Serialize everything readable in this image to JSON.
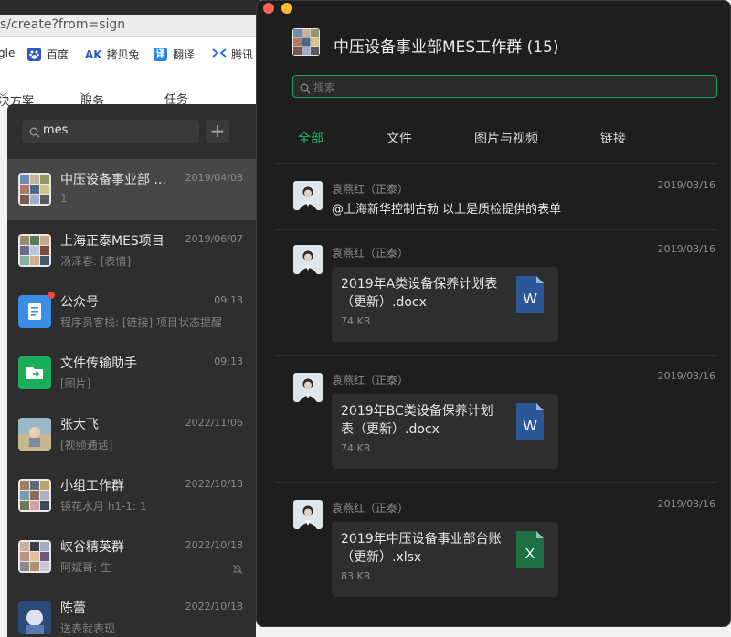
{
  "browser": {
    "url": "s/create?from=sign",
    "bookmarks": [
      {
        "label": "gle",
        "icon": "google-bookmark-icon",
        "color": "#ffffff"
      },
      {
        "label": "百度",
        "icon": "baidu-paw-icon",
        "color": "#2e57c8"
      },
      {
        "label": "拷贝兔",
        "icon": "ak-icon",
        "color": "#2e57c8",
        "icon_text": "AK"
      },
      {
        "label": "翻译",
        "icon": "translate-icon",
        "color": "#2a87e0",
        "icon_text": "译"
      },
      {
        "label": "腾讯",
        "icon": "tencent-icon",
        "color": "#2a6fe0"
      }
    ],
    "nav": [
      "决方案",
      "服务",
      "任务"
    ]
  },
  "chatlist": {
    "search_value": "mes",
    "items": [
      {
        "name": "中压设备事业部 ...",
        "date": "2019/04/08",
        "subtitle": "1",
        "active": true,
        "avatar": "group"
      },
      {
        "name": "上海正泰MES项目",
        "date": "2019/06/07",
        "subtitle": "汤泽春: [表情]",
        "avatar": "group"
      },
      {
        "name": "公众号",
        "date": "09:13",
        "subtitle": "程序员客栈: [链接] 项目状态提醒",
        "avatar": "official",
        "badge": true
      },
      {
        "name": "文件传输助手",
        "date": "09:13",
        "subtitle": "[图片]",
        "avatar": "transfer"
      },
      {
        "name": "张大飞",
        "date": "2022/11/06",
        "subtitle": "[视频通话]",
        "avatar": "photo"
      },
      {
        "name": "小组工作群",
        "date": "2022/10/18",
        "subtitle": "镜花水月 h1-1: 1",
        "avatar": "group"
      },
      {
        "name": "峡谷精英群",
        "date": "2022/10/18",
        "subtitle": "阿斌哥: 生",
        "avatar": "group",
        "muted": true
      },
      {
        "name": "陈蕾",
        "date": "2022/10/18",
        "subtitle": "送表就表现",
        "avatar": "photo"
      }
    ]
  },
  "window": {
    "title": "中压设备事业部MES工作群 (15)",
    "search_placeholder": "搜索",
    "tabs": [
      "全部",
      "文件",
      "图片与视频",
      "链接"
    ],
    "messages": [
      {
        "sender": "袁燕红（正泰）",
        "date": "2019/03/16",
        "type": "text",
        "text": "@上海新华控制古勃 以上是质检提供的表单"
      },
      {
        "sender": "袁燕红（正泰）",
        "date": "2019/03/16",
        "type": "file",
        "file_name": "2019年A类设备保养计划表（更新）.docx",
        "size": "74 KB",
        "kind": "W",
        "color": "#2b5797"
      },
      {
        "sender": "袁燕红（正泰）",
        "date": "2019/03/16",
        "type": "file",
        "file_name": "2019年BC类设备保养计划表（更新）.docx",
        "size": "74 KB",
        "kind": "W",
        "color": "#2b5797"
      },
      {
        "sender": "袁燕红（正泰）",
        "date": "2019/03/16",
        "type": "file",
        "file_name": "2019年中压设备事业部台账（更新）.xlsx",
        "size": "83 KB",
        "kind": "X",
        "color": "#1d7044"
      }
    ]
  },
  "colors": {
    "accent": "#20c16a",
    "dark_bg": "#1e1e1e",
    "list_bg": "#2e2e2e"
  }
}
